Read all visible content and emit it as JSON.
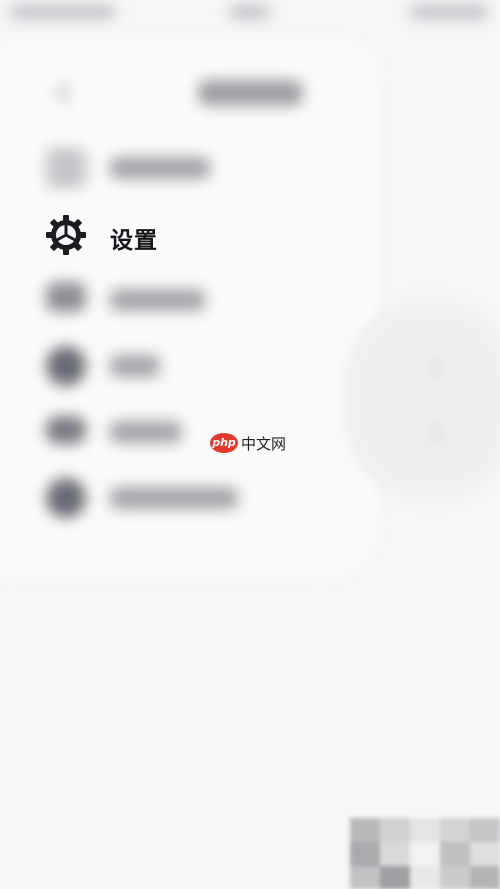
{
  "header": {
    "title": ""
  },
  "menu": {
    "settings_label": "设置",
    "blurred_items": [
      {
        "label": ""
      },
      {
        "label": ""
      },
      {
        "label": ""
      },
      {
        "label": ""
      },
      {
        "label": ""
      }
    ]
  },
  "watermark": {
    "brand": "php",
    "text": "中文网"
  },
  "colors": {
    "background": "#f5f6f7",
    "text": "#15171c",
    "watermark_red": "#e03a31"
  },
  "icons": {
    "settings": "gear-icon",
    "back": "back-icon"
  }
}
